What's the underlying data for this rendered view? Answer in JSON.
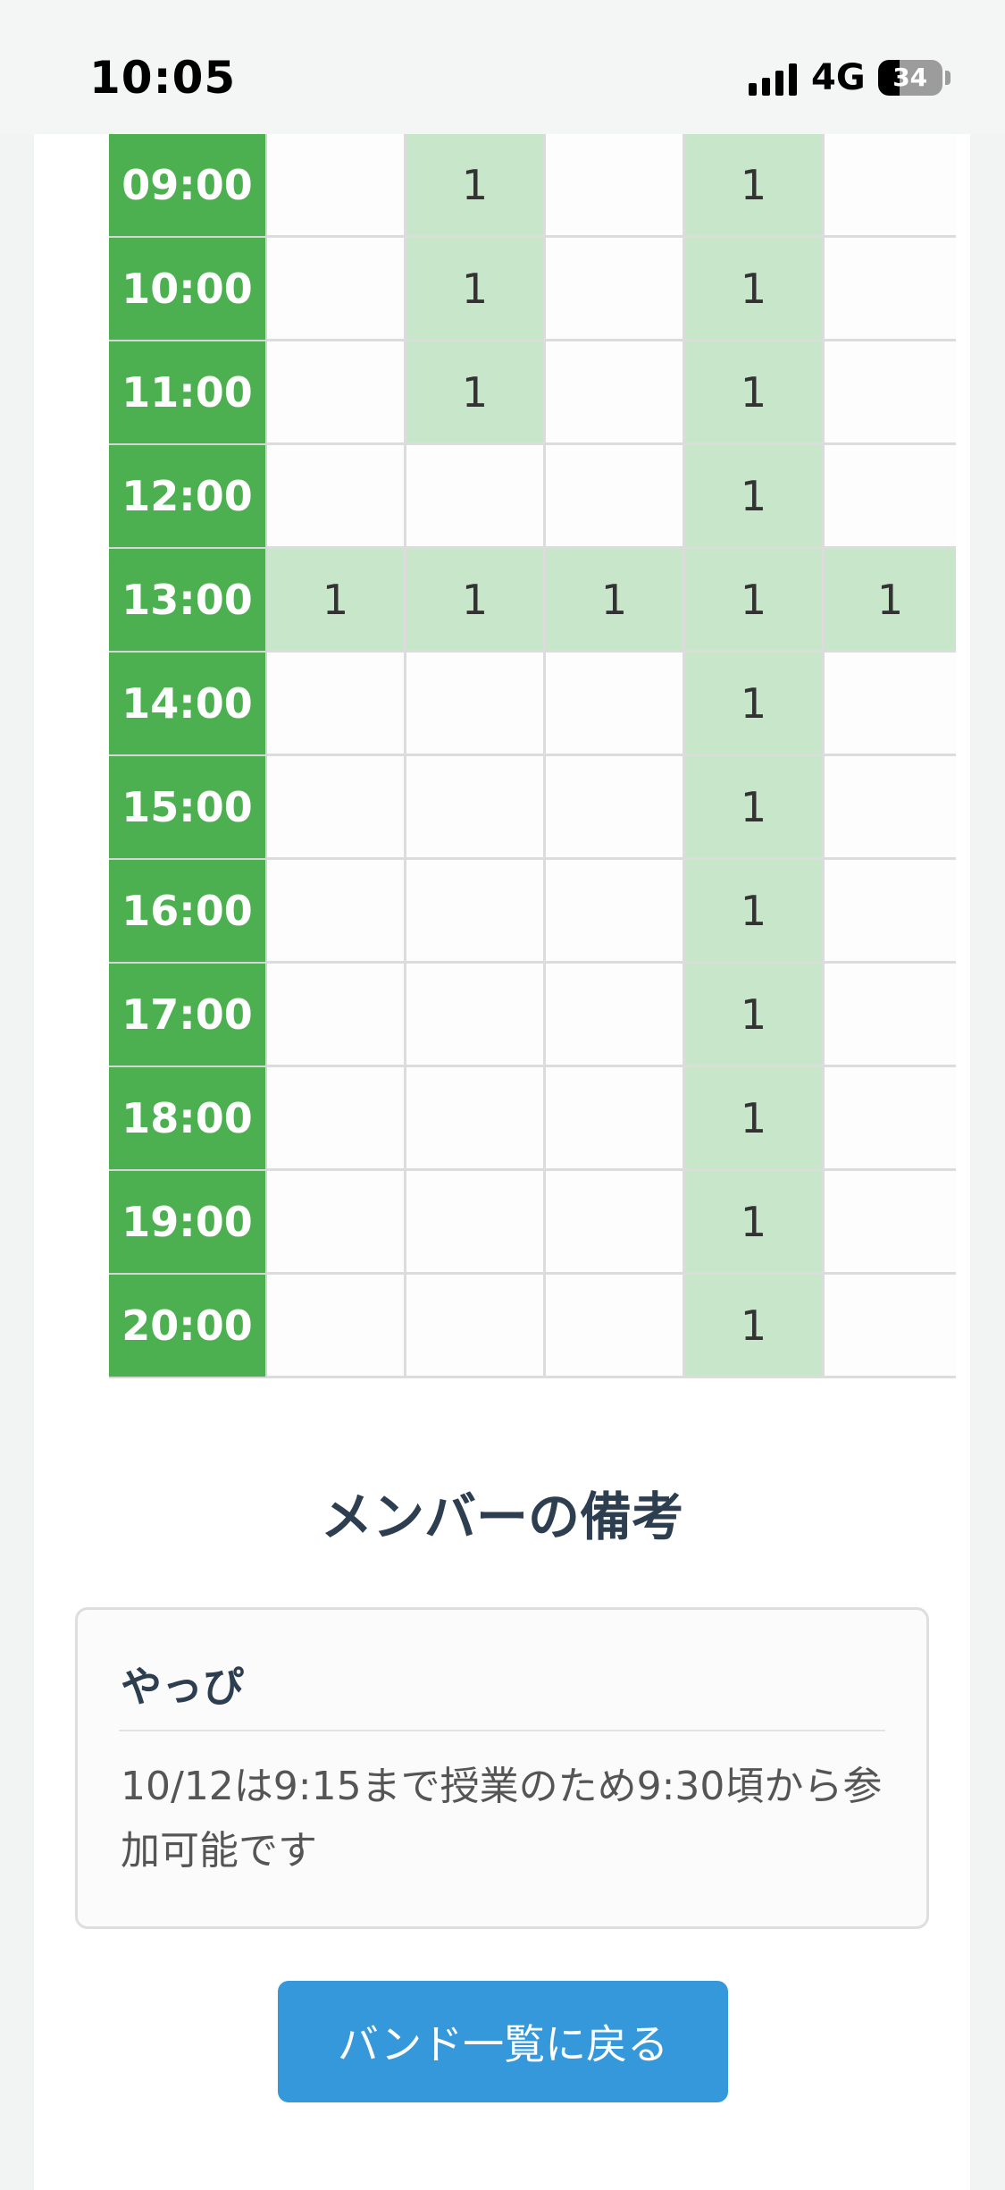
{
  "status_bar": {
    "time": "10:05",
    "network": "4G",
    "battery": "34"
  },
  "schedule": {
    "rows": [
      {
        "time": "09:00",
        "cells": [
          "",
          "1",
          "",
          "1",
          ""
        ]
      },
      {
        "time": "10:00",
        "cells": [
          "",
          "1",
          "",
          "1",
          ""
        ]
      },
      {
        "time": "11:00",
        "cells": [
          "",
          "1",
          "",
          "1",
          ""
        ]
      },
      {
        "time": "12:00",
        "cells": [
          "",
          "",
          "",
          "1",
          ""
        ]
      },
      {
        "time": "13:00",
        "cells": [
          "1",
          "1",
          "1",
          "1",
          "1"
        ]
      },
      {
        "time": "14:00",
        "cells": [
          "",
          "",
          "",
          "1",
          ""
        ]
      },
      {
        "time": "15:00",
        "cells": [
          "",
          "",
          "",
          "1",
          ""
        ]
      },
      {
        "time": "16:00",
        "cells": [
          "",
          "",
          "",
          "1",
          ""
        ]
      },
      {
        "time": "17:00",
        "cells": [
          "",
          "",
          "",
          "1",
          ""
        ]
      },
      {
        "time": "18:00",
        "cells": [
          "",
          "",
          "",
          "1",
          ""
        ]
      },
      {
        "time": "19:00",
        "cells": [
          "",
          "",
          "",
          "1",
          ""
        ]
      },
      {
        "time": "20:00",
        "cells": [
          "",
          "",
          "",
          "1",
          ""
        ]
      }
    ]
  },
  "notes": {
    "title": "メンバーの備考",
    "items": [
      {
        "name": "やっぴ",
        "text": "10/12は9:15まで授業のため9:30頃から参加可能です"
      }
    ]
  },
  "back_button": {
    "label": "バンド一覧に戻る"
  },
  "colors": {
    "time_column": "#4caf50",
    "available_cell": "#c8e6c9",
    "button": "#3498db",
    "heading": "#2c3e50"
  }
}
